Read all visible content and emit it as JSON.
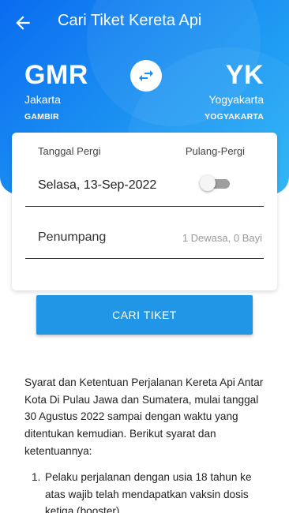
{
  "header": {
    "title": "Cari Tiket Kereta Api",
    "back_icon": "arrow-left-icon"
  },
  "route": {
    "origin": {
      "code": "GMR",
      "city": "Jakarta",
      "station": "GAMBIR"
    },
    "destination": {
      "code": "YK",
      "city": "Yogyakarta",
      "station": "YOGYAKARTA"
    },
    "swap_icon": "swap-horizontal-icon"
  },
  "form": {
    "departure_label": "Tanggal Pergi",
    "departure_value": "Selasa, 13-Sep-2022",
    "round_trip_label": "Pulang-Pergi",
    "round_trip_enabled": false,
    "passenger_label": "Penumpang",
    "passenger_value": "1 Dewasa, 0 Bayi"
  },
  "search_button_label": "CARI TIKET",
  "terms": {
    "intro": "Syarat dan Ketentuan Perjalanan Kereta Api Antar Kota Di Pulau Jawa dan Sumatera, mulai tanggal 30 Agustus 2022 sampai dengan waktu yang ditentukan kemudian. Berikut syarat dan ketentuannya:",
    "items": [
      {
        "number": "1.",
        "text": "Pelaku perjalanan dengan usia 18 tahun ke atas wajib telah mendapatkan vaksin dosis ketiga (booster)"
      }
    ]
  },
  "colors": {
    "hero_gradient_start": "#0a6cf0",
    "hero_gradient_end": "#27b3f6",
    "button": "#2196e6"
  }
}
